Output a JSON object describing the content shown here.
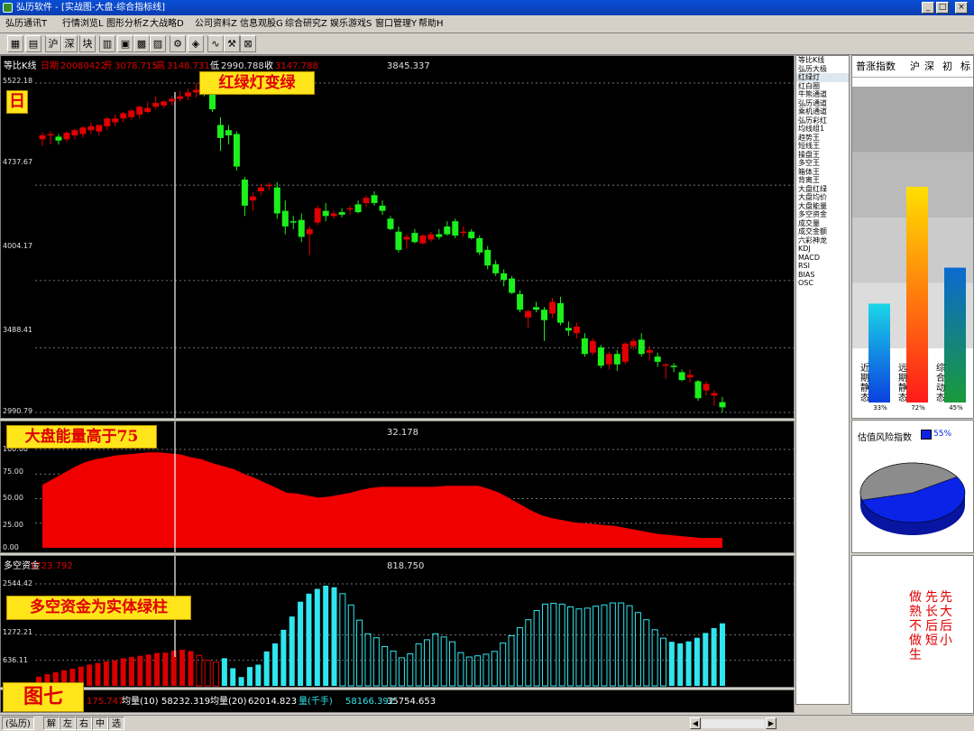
{
  "window": {
    "title": "弘历软件 - [实战图-大盘-综合指标线]",
    "min_label": "_",
    "max_label": "□",
    "close_label": "×"
  },
  "menu": [
    "弘历通讯T",
    "行情浏览L",
    "图形分析Z",
    "大战略D",
    "公司资料Z",
    "信息观股G",
    "综合研究Z",
    "娱乐游戏S",
    "窗口管理Y",
    "帮助H"
  ],
  "toolbar": {
    "buttons": [
      "沪",
      "深",
      "块"
    ],
    "brand": "弘历"
  },
  "candle_panel": {
    "name": "等比K线",
    "period_label": "日期",
    "date": "20080422",
    "open_label": "开",
    "open": "3078.715",
    "high_label": "高",
    "high": "3148.731",
    "low_label": "低",
    "low": "2990.788",
    "close_label": "收",
    "close": "3147.788",
    "center_value": "3845.337",
    "period_tag": "日",
    "axis": [
      "5522.18",
      "4737.67",
      "4004.17",
      "3488.41",
      "2990.79"
    ],
    "ymin": 2990.79,
    "ymax": 5522.18,
    "candles": [
      [
        5090,
        5140,
        5040,
        5120
      ],
      [
        5120,
        5150,
        5050,
        5130
      ],
      [
        5110,
        5130,
        5050,
        5080
      ],
      [
        5090,
        5150,
        5070,
        5140
      ],
      [
        5120,
        5170,
        5090,
        5160
      ],
      [
        5130,
        5190,
        5100,
        5180
      ],
      [
        5160,
        5220,
        5130,
        5190
      ],
      [
        5150,
        5200,
        5120,
        5200
      ],
      [
        5190,
        5260,
        5160,
        5250
      ],
      [
        5220,
        5280,
        5190,
        5250
      ],
      [
        5250,
        5300,
        5220,
        5290
      ],
      [
        5260,
        5320,
        5240,
        5310
      ],
      [
        5280,
        5350,
        5250,
        5340
      ],
      [
        5300,
        5380,
        5290,
        5330
      ],
      [
        5340,
        5420,
        5320,
        5370
      ],
      [
        5350,
        5390,
        5330,
        5380
      ],
      [
        5380,
        5420,
        5350,
        5400
      ],
      [
        5400,
        5460,
        5380,
        5420
      ],
      [
        5420,
        5480,
        5390,
        5450
      ],
      [
        5450,
        5522,
        5410,
        5470
      ],
      [
        5460,
        5500,
        5420,
        5440
      ],
      [
        5450,
        5470,
        5300,
        5320
      ],
      [
        5200,
        5260,
        5000,
        5100
      ],
      [
        5160,
        5200,
        5050,
        5120
      ],
      [
        5130,
        5150,
        4850,
        4880
      ],
      [
        4780,
        4800,
        4500,
        4580
      ],
      [
        4620,
        4680,
        4540,
        4650
      ],
      [
        4690,
        4750,
        4660,
        4720
      ],
      [
        4730,
        4760,
        4700,
        4740
      ],
      [
        4720,
        4760,
        4480,
        4520
      ],
      [
        4540,
        4620,
        4360,
        4420
      ],
      [
        4460,
        4500,
        4400,
        4450
      ],
      [
        4470,
        4520,
        4300,
        4340
      ],
      [
        4360,
        4420,
        4200,
        4400
      ],
      [
        4450,
        4580,
        4430,
        4560
      ],
      [
        4540,
        4600,
        4460,
        4500
      ],
      [
        4500,
        4540,
        4480,
        4520
      ],
      [
        4530,
        4560,
        4490,
        4510
      ],
      [
        4550,
        4580,
        4510,
        4560
      ],
      [
        4590,
        4620,
        4520,
        4530
      ],
      [
        4600,
        4660,
        4570,
        4640
      ],
      [
        4660,
        4690,
        4580,
        4600
      ],
      [
        4580,
        4620,
        4510,
        4540
      ],
      [
        4480,
        4500,
        4390,
        4400
      ],
      [
        4380,
        4420,
        4220,
        4240
      ],
      [
        4320,
        4360,
        4250,
        4340
      ],
      [
        4370,
        4400,
        4290,
        4300
      ],
      [
        4290,
        4360,
        4280,
        4350
      ],
      [
        4320,
        4380,
        4300,
        4360
      ],
      [
        4360,
        4400,
        4320,
        4340
      ],
      [
        4420,
        4460,
        4350,
        4360
      ],
      [
        4460,
        4480,
        4330,
        4350
      ],
      [
        4380,
        4420,
        4340,
        4380
      ],
      [
        4380,
        4400,
        4320,
        4330
      ],
      [
        4330,
        4350,
        4200,
        4220
      ],
      [
        4240,
        4270,
        4090,
        4120
      ],
      [
        4130,
        4160,
        4040,
        4060
      ],
      [
        4060,
        4090,
        3960,
        4010
      ],
      [
        4020,
        4040,
        3900,
        3910
      ],
      [
        3900,
        3930,
        3760,
        3780
      ],
      [
        3720,
        3780,
        3640,
        3770
      ],
      [
        3800,
        3840,
        3760,
        3780
      ],
      [
        3780,
        3800,
        3540,
        3700
      ],
      [
        3750,
        3870,
        3720,
        3840
      ],
      [
        3830,
        3880,
        3660,
        3680
      ],
      [
        3640,
        3690,
        3580,
        3620
      ],
      [
        3600,
        3680,
        3560,
        3650
      ],
      [
        3560,
        3600,
        3420,
        3440
      ],
      [
        3450,
        3560,
        3430,
        3540
      ],
      [
        3490,
        3510,
        3330,
        3350
      ],
      [
        3360,
        3460,
        3320,
        3440
      ],
      [
        3440,
        3470,
        3310,
        3360
      ],
      [
        3380,
        3530,
        3360,
        3520
      ],
      [
        3500,
        3560,
        3470,
        3540
      ],
      [
        3550,
        3600,
        3420,
        3440
      ],
      [
        3450,
        3500,
        3390,
        3470
      ],
      [
        3420,
        3450,
        3340,
        3380
      ],
      [
        3350,
        3370,
        3250,
        3360
      ],
      [
        3350,
        3370,
        3300,
        3340
      ],
      [
        3300,
        3320,
        3230,
        3240
      ],
      [
        3260,
        3320,
        3220,
        3280
      ],
      [
        3230,
        3240,
        3080,
        3100
      ],
      [
        3160,
        3230,
        3120,
        3210
      ],
      [
        3120,
        3160,
        3040,
        3140
      ],
      [
        3070,
        3110,
        2990,
        3030
      ]
    ]
  },
  "energy_panel": {
    "name": "大盘能量",
    "center_value": "32.178",
    "axis": [
      "100.00",
      "75.00",
      "50.00",
      "25.00",
      "0.00"
    ],
    "values": [
      64,
      70,
      76,
      82,
      87,
      90,
      92,
      94,
      95,
      96,
      97,
      97,
      96,
      95,
      92,
      90,
      86,
      83,
      80,
      75,
      71,
      66,
      61,
      56,
      55,
      53,
      51,
      52,
      54,
      56,
      59,
      61,
      62,
      62,
      62,
      62,
      62,
      62,
      63,
      63,
      63,
      63,
      60,
      56,
      50,
      44,
      38,
      33,
      30,
      28,
      26,
      25,
      24,
      23,
      22,
      20,
      18,
      16,
      14,
      13,
      12,
      11,
      10,
      10,
      10
    ]
  },
  "money_panel": {
    "name": "多空资金",
    "name_value": "1723.792",
    "center_value": "818.750",
    "axis": [
      "2544.42",
      "1272.21",
      "636.11"
    ],
    "ymax": 2544.42,
    "values": [
      [
        230,
        "r"
      ],
      [
        290,
        "r"
      ],
      [
        340,
        "r"
      ],
      [
        390,
        "r"
      ],
      [
        430,
        "r"
      ],
      [
        480,
        "r"
      ],
      [
        530,
        "r"
      ],
      [
        570,
        "r"
      ],
      [
        610,
        "r"
      ],
      [
        640,
        "r"
      ],
      [
        690,
        "r"
      ],
      [
        720,
        "r"
      ],
      [
        750,
        "r"
      ],
      [
        780,
        "r"
      ],
      [
        820,
        "r"
      ],
      [
        830,
        "r"
      ],
      [
        880,
        "r"
      ],
      [
        900,
        "r"
      ],
      [
        870,
        "r"
      ],
      [
        760,
        "ro"
      ],
      [
        640,
        "ro"
      ],
      [
        590,
        "ro"
      ],
      [
        690,
        "g"
      ],
      [
        440,
        "g"
      ],
      [
        220,
        "g"
      ],
      [
        470,
        "g"
      ],
      [
        530,
        "g"
      ],
      [
        860,
        "g"
      ],
      [
        1060,
        "g"
      ],
      [
        1400,
        "g"
      ],
      [
        1730,
        "g"
      ],
      [
        2100,
        "g"
      ],
      [
        2300,
        "g"
      ],
      [
        2420,
        "g"
      ],
      [
        2500,
        "g"
      ],
      [
        2460,
        "g"
      ],
      [
        2300,
        "go"
      ],
      [
        2020,
        "go"
      ],
      [
        1640,
        "go"
      ],
      [
        1300,
        "go"
      ],
      [
        1200,
        "go"
      ],
      [
        980,
        "go"
      ],
      [
        870,
        "go"
      ],
      [
        700,
        "go"
      ],
      [
        800,
        "go"
      ],
      [
        1050,
        "go"
      ],
      [
        1150,
        "go"
      ],
      [
        1300,
        "go"
      ],
      [
        1220,
        "go"
      ],
      [
        1100,
        "go"
      ],
      [
        830,
        "go"
      ],
      [
        720,
        "go"
      ],
      [
        750,
        "go"
      ],
      [
        790,
        "go"
      ],
      [
        860,
        "go"
      ],
      [
        1070,
        "go"
      ],
      [
        1250,
        "go"
      ],
      [
        1450,
        "go"
      ],
      [
        1650,
        "go"
      ],
      [
        1880,
        "go"
      ],
      [
        2040,
        "go"
      ],
      [
        2060,
        "go"
      ],
      [
        2040,
        "go"
      ],
      [
        1970,
        "go"
      ],
      [
        1920,
        "go"
      ],
      [
        1940,
        "go"
      ],
      [
        1990,
        "go"
      ],
      [
        2020,
        "go"
      ],
      [
        2070,
        "go"
      ],
      [
        2070,
        "go"
      ],
      [
        2000,
        "go"
      ],
      [
        1830,
        "go"
      ],
      [
        1650,
        "go"
      ],
      [
        1400,
        "go"
      ],
      [
        1190,
        "go"
      ],
      [
        1100,
        "g"
      ],
      [
        1060,
        "g"
      ],
      [
        1110,
        "g"
      ],
      [
        1200,
        "g"
      ],
      [
        1320,
        "g"
      ],
      [
        1440,
        "g"
      ],
      [
        1560,
        "g"
      ]
    ]
  },
  "callouts": {
    "red_green_light": "红绿灯变绿",
    "energy_above": "大盘能量高于75",
    "money_green": "多空资金为实体绿柱",
    "figure": "图七"
  },
  "indicator_list": [
    "等比K线",
    "弘历大极",
    "红绿灯",
    "红白圈",
    "牛熊通道",
    "弘历通道",
    "乘机通道",
    "弘历彩红",
    "均线组1",
    "趋势王",
    "短线王",
    "操盘王",
    "多空王",
    "箱体王",
    "背离王",
    "大盘红绿",
    "大盘均价",
    "大盘能量",
    "多空资金",
    "成交量",
    "成交金额",
    "六彩神龙",
    "KDJ",
    "MACD",
    "RSI",
    "BIAS",
    "OSC"
  ],
  "ratio_panel": {
    "title": "普涨指数",
    "tabs": [
      "沪",
      "深",
      "初",
      "标"
    ],
    "bars": [
      {
        "label": "近期静态",
        "pct_label": "33%",
        "pct": 0.33
      },
      {
        "label": "远期静态",
        "pct_label": "72%",
        "pct": 0.72
      },
      {
        "label": "综合动态",
        "pct_label": "45%",
        "pct": 0.45
      }
    ]
  },
  "risk_panel": {
    "title": "估值风险指数",
    "pct_label": "55%",
    "pct": 0.55,
    "colors": {
      "blue": "#0a23e6",
      "grey": "#8c8c8c"
    }
  },
  "note_panel": {
    "col1": "先大后小",
    "col2": "先长后短",
    "col3": "做熟不做生"
  },
  "bottom_status": {
    "name_value": "175.747",
    "vol10_label": "均量(10)",
    "vol10": "58232.319",
    "vol20_label": "均量(20)",
    "vol20": "62014.823",
    "vol_label": "量(千手)",
    "vol": "58166.392",
    "extra": "35754.653"
  },
  "statusbar": {
    "title": "弘历",
    "items": [
      "解",
      "左",
      "右",
      "中",
      "选"
    ]
  },
  "colors": {
    "up": "#e00000",
    "down": "#1cf01c",
    "energy": "#f00000",
    "money_red": "#d80000",
    "money_green": "#2fe6ee",
    "bg": "#000000"
  }
}
